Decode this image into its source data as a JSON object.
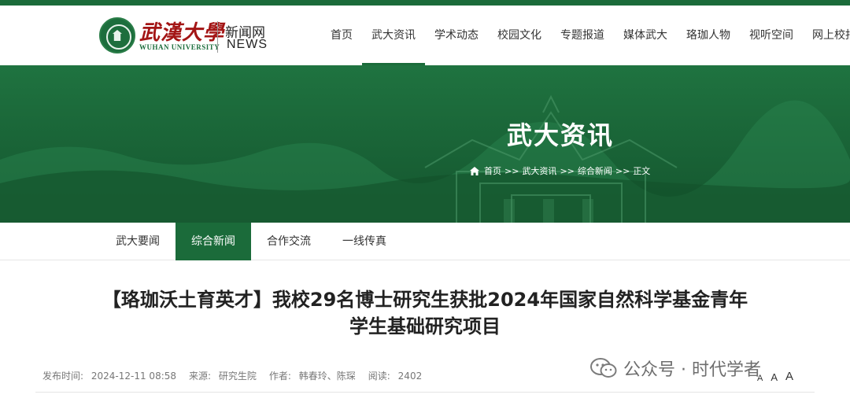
{
  "header": {
    "brand_cn": "武漢大學",
    "brand_en": "WUHAN UNIVERSITY",
    "site_cn": "新闻网",
    "site_en": "NEWS"
  },
  "nav": {
    "items": [
      {
        "label": "首页"
      },
      {
        "label": "武大资讯"
      },
      {
        "label": "学术动态"
      },
      {
        "label": "校园文化"
      },
      {
        "label": "专题报道"
      },
      {
        "label": "媒体武大"
      },
      {
        "label": "珞珈人物"
      },
      {
        "label": "视听空间"
      },
      {
        "label": "网上校报"
      }
    ],
    "active_index": 1
  },
  "banner": {
    "title": "武大资讯",
    "breadcrumb": [
      "首页",
      ">>",
      "武大资讯",
      ">>",
      "综合新闻",
      ">>",
      "正文"
    ]
  },
  "subnav": {
    "tabs": [
      {
        "label": "武大要闻"
      },
      {
        "label": "综合新闻"
      },
      {
        "label": "合作交流"
      },
      {
        "label": "一线传真"
      }
    ],
    "active_index": 1
  },
  "article": {
    "title_line1": "【珞珈沃土育英才】我校29名博士研究生获批2024年国家自然科学基金青年",
    "title_line2": "学生基础研究项目",
    "meta": {
      "date_label": "发布时间:",
      "date_value": "2024-12-11 08:58",
      "source_label": "来源:",
      "source_value": "研究生院",
      "author_label": "作者:",
      "author_value": "韩春玲、陈琛",
      "reads_label": "阅读:",
      "reads_value": "2402"
    },
    "font_size_controls": [
      "A",
      "A",
      "A"
    ]
  },
  "watermark": {
    "text": "公众号 · 时代学者"
  },
  "colors": {
    "brand_green": "#1b6b3a",
    "brand_red": "#a31515"
  }
}
